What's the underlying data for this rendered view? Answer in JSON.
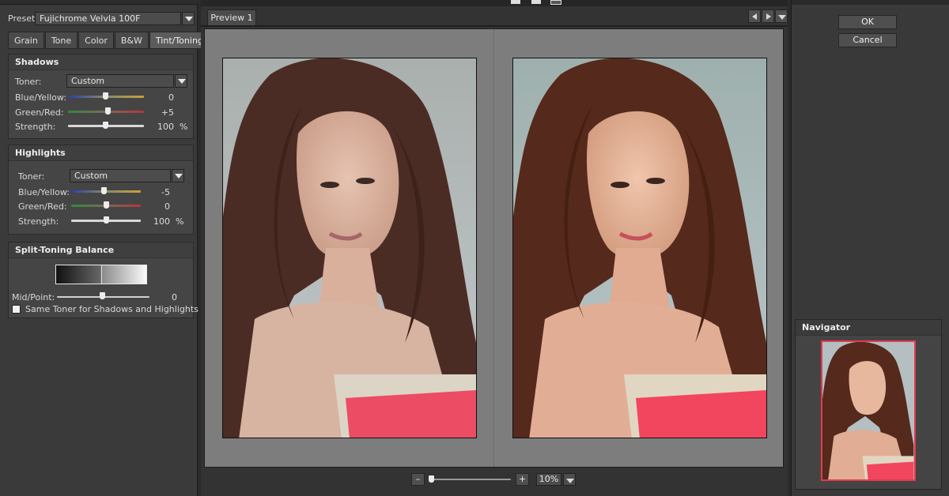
{
  "settings": {
    "preset_label": "Preset",
    "preset_value": "Fujichrome Velvla 100F",
    "tabs": [
      "Grain",
      "Tone",
      "Color",
      "B&W",
      "Tint/Toning"
    ],
    "active_tab": "Tint/Toning",
    "shadows": {
      "title": "Shadows",
      "toner_label": "Toner:",
      "toner_value": "Custom",
      "blue_yellow_label": "Blue/Yellow:",
      "blue_yellow_value": "0",
      "green_red_label": "Green/Red:",
      "green_red_value": "+5",
      "strength_label": "Strength:",
      "strength_value": "100",
      "strength_unit": "%"
    },
    "highlights": {
      "title": "Highlights",
      "toner_label": "Toner:",
      "toner_value": "Custom",
      "blue_yellow_label": "Blue/Yellow:",
      "blue_yellow_value": "-5",
      "green_red_label": "Green/Red:",
      "green_red_value": "0",
      "strength_label": "Strength:",
      "strength_value": "100",
      "strength_unit": "%"
    },
    "split_toning": {
      "title": "Split-Toning Balance",
      "midpoint_label": "Mid/Point:",
      "midpoint_value": "0",
      "same_toner_label": "Same Toner for Shadows and Highlights",
      "same_toner_checked": false
    }
  },
  "preview": {
    "tab_label": "Preview 1",
    "zoom_value": "10%",
    "zoom_minus": "–",
    "zoom_plus": "+"
  },
  "actions": {
    "ok_label": "OK",
    "cancel_label": "Cancel"
  },
  "navigator": {
    "title": "Navigator"
  },
  "colors": {
    "highlight_frame": "#e23a4e",
    "canvas_gray": "#7d7d7d"
  }
}
